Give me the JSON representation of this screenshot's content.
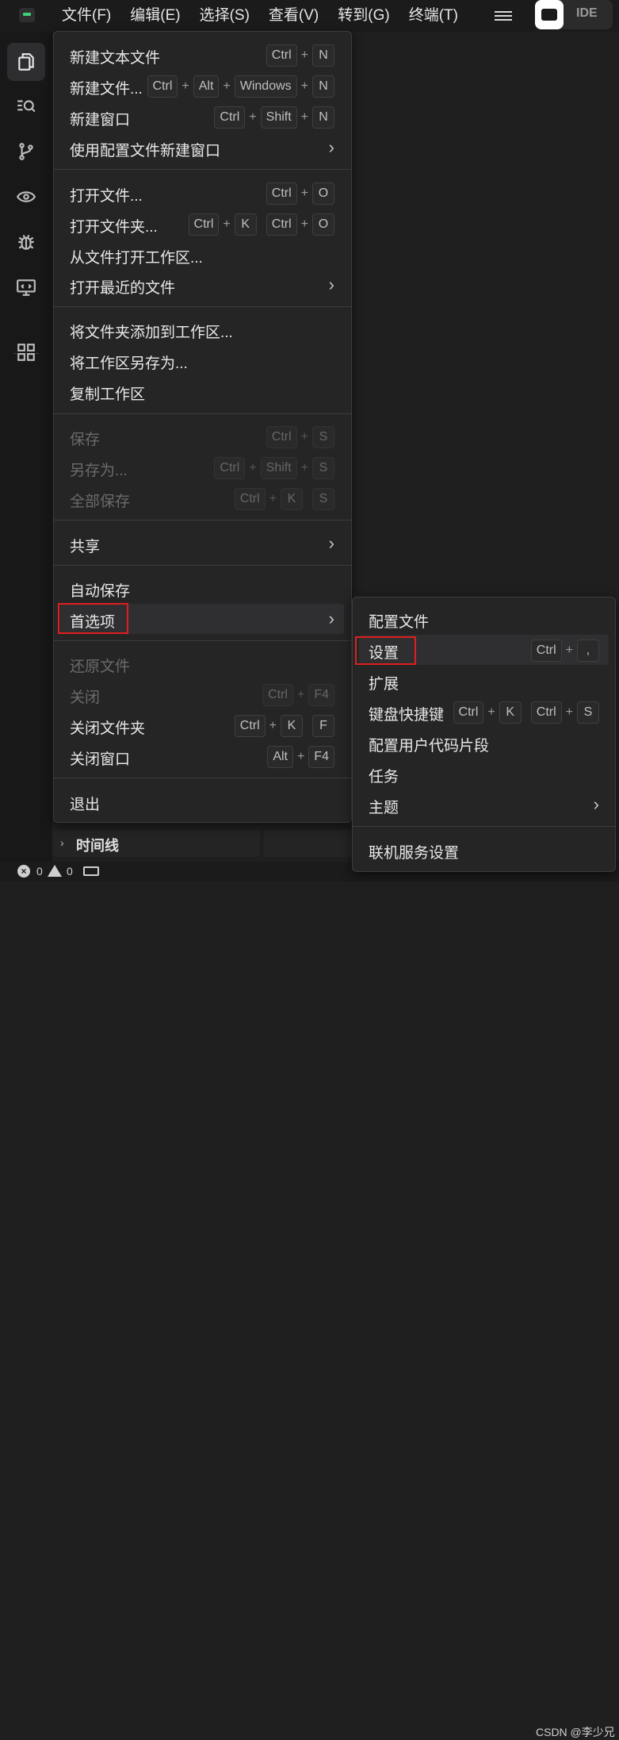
{
  "menubar": {
    "items": [
      "文件(F)",
      "编辑(E)",
      "选择(S)",
      "查看(V)",
      "转到(G)",
      "终端(T)"
    ],
    "ide_label": "IDE"
  },
  "activity_icons": [
    "explorer-icon",
    "search-icon",
    "source-control-icon",
    "preview-icon",
    "debug-icon",
    "remote-icon",
    "extensions-icon"
  ],
  "file_menu": {
    "items": [
      {
        "label": "新建文本文件",
        "keys": [
          "Ctrl",
          "N"
        ]
      },
      {
        "label": "新建文件...",
        "keys": [
          "Ctrl",
          "Alt",
          "Windows",
          "N"
        ]
      },
      {
        "label": "新建窗口",
        "keys": [
          "Ctrl",
          "Shift",
          "N"
        ]
      },
      {
        "label": "使用配置文件新建窗口",
        "arrow": "›"
      },
      {
        "label": "打开文件...",
        "keys": [
          "Ctrl",
          "O"
        ]
      },
      {
        "label": "打开文件夹...",
        "chord1": [
          "Ctrl",
          "K"
        ],
        "chord2": [
          "Ctrl",
          "O"
        ]
      },
      {
        "label": "从文件打开工作区..."
      },
      {
        "label": "打开最近的文件",
        "arrow": "›"
      },
      {
        "label": "将文件夹添加到工作区..."
      },
      {
        "label": "将工作区另存为..."
      },
      {
        "label": "复制工作区"
      },
      {
        "label": "保存",
        "keys": [
          "Ctrl",
          "S"
        ]
      },
      {
        "label": "另存为...",
        "keys": [
          "Ctrl",
          "Shift",
          "S"
        ]
      },
      {
        "label": "全部保存",
        "chord1": [
          "Ctrl",
          "K"
        ],
        "single": "S"
      },
      {
        "label": "共享",
        "arrow": "›"
      },
      {
        "label": "自动保存"
      },
      {
        "label": "首选项",
        "arrow": "›"
      },
      {
        "label": "还原文件"
      },
      {
        "label": "关闭",
        "keys": [
          "Ctrl",
          "F4"
        ]
      },
      {
        "label": "关闭文件夹",
        "chord1": [
          "Ctrl",
          "K"
        ],
        "single": "F"
      },
      {
        "label": "关闭窗口",
        "keys": [
          "Alt",
          "F4"
        ]
      },
      {
        "label": "退出"
      }
    ]
  },
  "preferences_submenu": {
    "items": [
      {
        "label": "配置文件"
      },
      {
        "label": "设置",
        "keys": [
          "Ctrl",
          ","
        ]
      },
      {
        "label": "扩展"
      },
      {
        "label": "键盘快捷键",
        "chord1": [
          "Ctrl",
          "K"
        ],
        "chord2": [
          "Ctrl",
          "S"
        ]
      },
      {
        "label": "配置用户代码片段"
      },
      {
        "label": "任务"
      },
      {
        "label": "主题",
        "arrow": "›"
      },
      {
        "label": "联机服务设置"
      }
    ]
  },
  "sidebar": {
    "timeline_label": "时间线",
    "chevron": "›"
  },
  "statusbar": {
    "errors": "0",
    "warnings": "0",
    "error_glyph": "×"
  },
  "watermark": "CSDN @李少兄"
}
